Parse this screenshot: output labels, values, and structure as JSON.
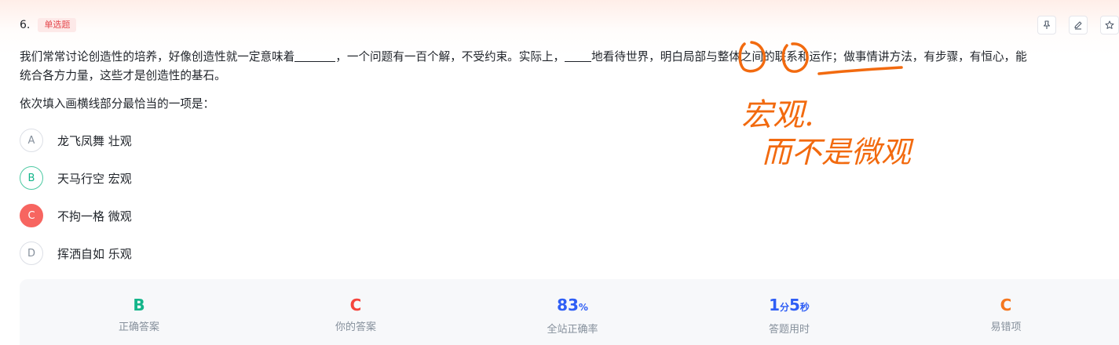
{
  "question": {
    "number": "6.",
    "type_badge": "单选题",
    "stem_line1_a": "我们常常讨论创造性的培养，好像创造性就一定意味着",
    "stem_line1_b": "，一个问题有一百个解，不受约束。实际上，",
    "stem_line1_c": "地看待世界，明白局部与整体之间的联系和运作；做事情讲方法，有步骤，有恒心，能",
    "stem_line2": "统合各方力量，这些才是创造性的基石。",
    "ask": "依次填入画横线部分最恰当的一项是："
  },
  "toolbar": {
    "pin_icon": "pin-icon",
    "edit_icon": "edit-icon",
    "star_icon": "star-icon"
  },
  "options": [
    {
      "letter": "A",
      "text": "龙飞凤舞 壮观",
      "state": "normal"
    },
    {
      "letter": "B",
      "text": "天马行空 宏观",
      "state": "correct"
    },
    {
      "letter": "C",
      "text": "不拘一格 微观",
      "state": "wrong"
    },
    {
      "letter": "D",
      "text": "挥洒自如 乐观",
      "state": "normal"
    }
  ],
  "stats": {
    "correct_answer": {
      "value": "B",
      "label": "正确答案",
      "color": "#14b58a"
    },
    "your_answer": {
      "value": "C",
      "label": "你的答案",
      "color": "#f5453d"
    },
    "site_accuracy": {
      "value": "83",
      "unit": "%",
      "label": "全站正确率",
      "color": "#2f5ef5"
    },
    "time_used": {
      "min": "1",
      "min_unit": "分",
      "sec": "5",
      "sec_unit": "秒",
      "label": "答题用时",
      "color": "#2f5ef5"
    },
    "common_wrong": {
      "value": "C",
      "label": "易错项",
      "color": "#f5771f"
    }
  },
  "handwriting": {
    "note_line1": "宏观.",
    "note_line2": "而不是微观",
    "ink_color": "#f26a0f"
  }
}
